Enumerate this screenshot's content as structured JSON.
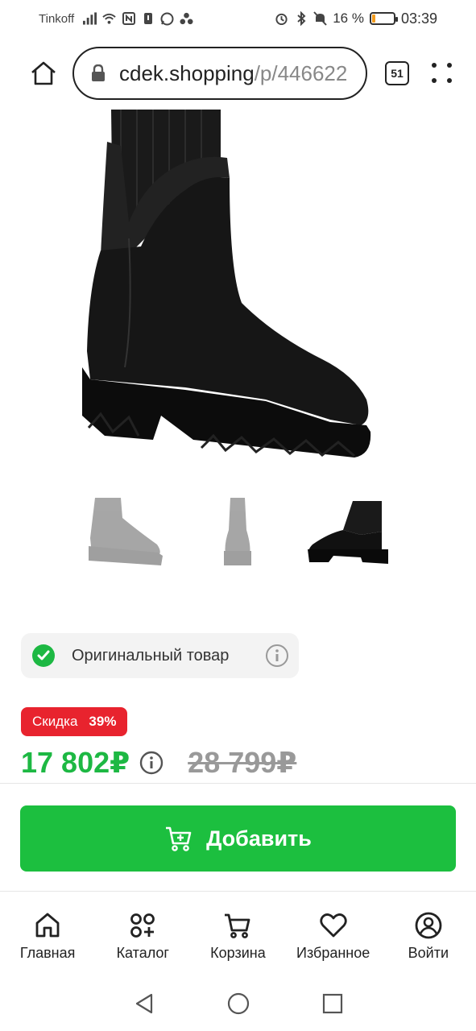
{
  "status_bar": {
    "carrier": "Tinkoff",
    "battery_percent": "16 %",
    "battery_level": 0.16,
    "time": "03:39"
  },
  "browser": {
    "url_host": "cdek.shopping",
    "url_path": "/p/446622",
    "tab_count": "51"
  },
  "product": {
    "original_label": "Оригинальный товар",
    "discount_label": "Скидка",
    "discount_value": "39%",
    "price_current": "17 802₽",
    "price_old": "28 799₽",
    "selected_thumbnail": 3
  },
  "cta": {
    "add_label": "Добавить"
  },
  "bottom_nav": [
    {
      "label": "Главная",
      "icon": "home-icon"
    },
    {
      "label": "Каталог",
      "icon": "catalog-icon"
    },
    {
      "label": "Корзина",
      "icon": "cart-icon"
    },
    {
      "label": "Избранное",
      "icon": "heart-icon"
    },
    {
      "label": "Войти",
      "icon": "user-icon"
    }
  ],
  "colors": {
    "accent_green": "#1cbf3f",
    "discount_red": "#e8232e",
    "old_price_gray": "#999999"
  }
}
